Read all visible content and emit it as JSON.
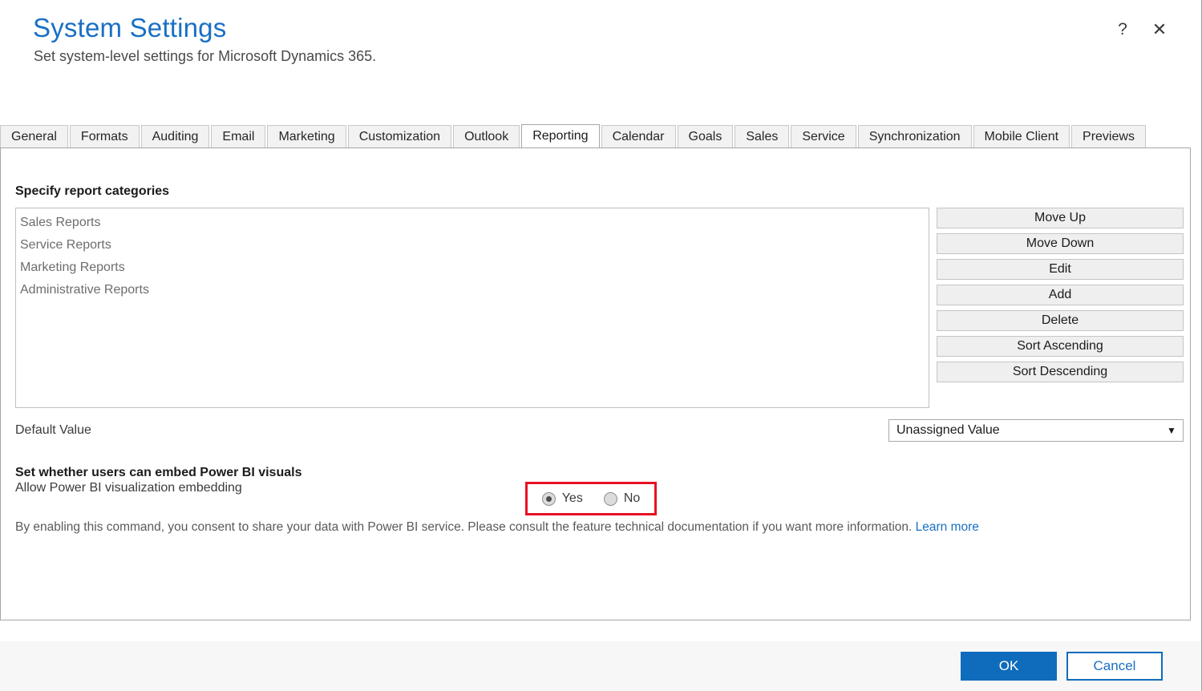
{
  "window": {
    "title": "System Settings",
    "subtitle": "Set system-level settings for Microsoft Dynamics 365.",
    "help_icon": "?",
    "close_icon": "✕",
    "accent_color": "#1a6fc4",
    "highlight_color": "#e81123"
  },
  "tabs": [
    {
      "label": "General",
      "active": false
    },
    {
      "label": "Formats",
      "active": false
    },
    {
      "label": "Auditing",
      "active": false
    },
    {
      "label": "Email",
      "active": false
    },
    {
      "label": "Marketing",
      "active": false
    },
    {
      "label": "Customization",
      "active": false
    },
    {
      "label": "Outlook",
      "active": false
    },
    {
      "label": "Reporting",
      "active": true
    },
    {
      "label": "Calendar",
      "active": false
    },
    {
      "label": "Goals",
      "active": false
    },
    {
      "label": "Sales",
      "active": false
    },
    {
      "label": "Service",
      "active": false
    },
    {
      "label": "Synchronization",
      "active": false
    },
    {
      "label": "Mobile Client",
      "active": false
    },
    {
      "label": "Previews",
      "active": false
    }
  ],
  "report_categories": {
    "heading": "Specify report categories",
    "items": [
      "Sales Reports",
      "Service Reports",
      "Marketing Reports",
      "Administrative Reports"
    ],
    "buttons": [
      "Move Up",
      "Move Down",
      "Edit",
      "Add",
      "Delete",
      "Sort Ascending",
      "Sort Descending"
    ]
  },
  "default_value": {
    "label": "Default Value",
    "selected": "Unassigned Value",
    "arrow_icon": "▼"
  },
  "power_bi": {
    "heading": "Set whether users can embed Power BI visuals",
    "row_label": "Allow Power BI visualization embedding",
    "options": [
      {
        "label": "Yes",
        "checked": true
      },
      {
        "label": "No",
        "checked": false
      }
    ],
    "consent_text": "By enabling this command, you consent to share your data with Power BI service. Please consult the feature technical documentation if you want more information. ",
    "learn_more": "Learn more"
  },
  "footer": {
    "ok_label": "OK",
    "cancel_label": "Cancel"
  }
}
